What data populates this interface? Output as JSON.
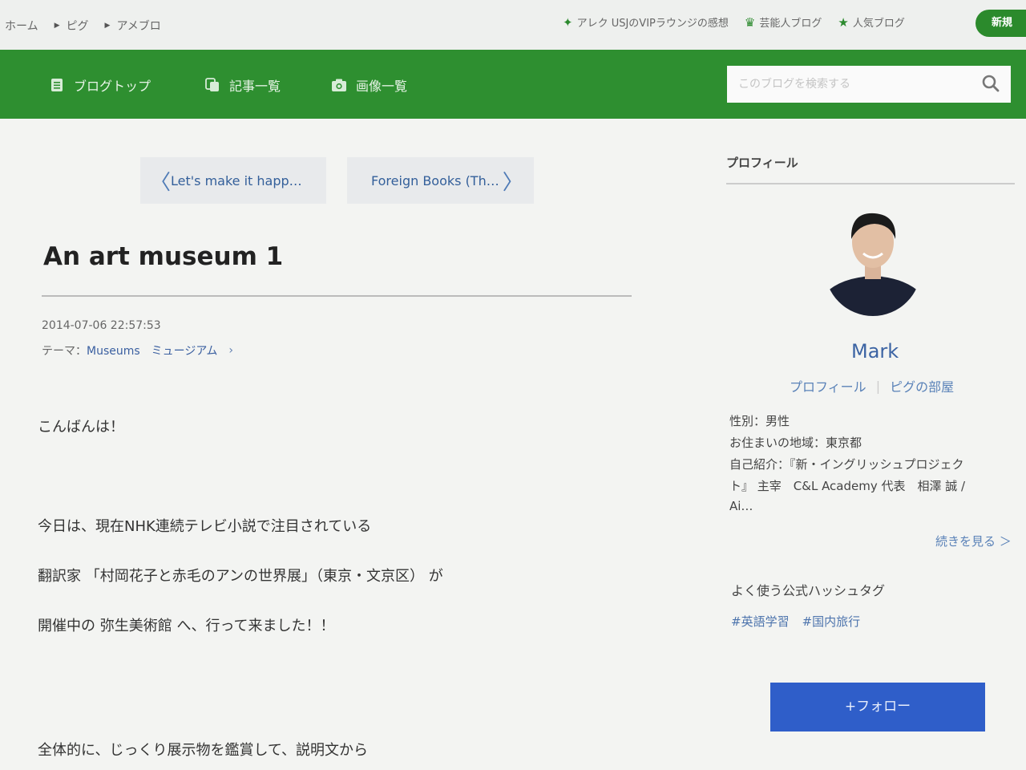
{
  "breadcrumb": [
    "ホーム",
    "ピグ",
    "アメブロ"
  ],
  "header_links": [
    {
      "label": "アレク USJのVIPラウンジの感想",
      "icon": "sparkle-icon"
    },
    {
      "label": "芸能人ブログ",
      "icon": "crown-icon"
    },
    {
      "label": "人気ブログ",
      "icon": "star-icon"
    }
  ],
  "new_button_label": "新規",
  "nav": {
    "items": [
      {
        "label": "ブログトップ",
        "icon": "document-icon"
      },
      {
        "label": "記事一覧",
        "icon": "copy-icon"
      },
      {
        "label": "画像一覧",
        "icon": "camera-icon"
      }
    ],
    "search_placeholder": "このブログを検索する"
  },
  "article": {
    "prev_label": "Let's make it happ…",
    "next_label": "Foreign Books (Th…",
    "title": "An art museum 1",
    "date": "2014-07-06 22:57:53",
    "theme_prefix": "テーマ：",
    "theme_link": "Museums　ミュージアム",
    "body": [
      "こんばんは！",
      "今日は、現在NHK連続テレビ小説で注目されている",
      "翻訳家 「村岡花子と赤毛のアンの世界展」（東京・文京区） が",
      "開催中の 弥生美術館 へ、行って来ました！！",
      "全体的に、じっくり展示物を鑑賞して、説明文から"
    ]
  },
  "sidebar": {
    "heading": "プロフィール",
    "username": "Mark",
    "links": [
      "プロフィール",
      "ピグの部屋"
    ],
    "info": [
      "性別：男性",
      "お住まいの地域：東京都",
      "自己紹介：『新・イングリッシュプロジェク",
      "ト』 主宰　C&L Academy 代表　相澤 誠 /",
      "Ai…"
    ],
    "more_label": "続きを見る ＞",
    "hashtag_heading": "よく使う公式ハッシュタグ",
    "hashtags": [
      "#英語学習",
      "#国内旅行"
    ],
    "follow_label": "+フォロー"
  },
  "colors": {
    "nav_green": "#2e8f30",
    "link_blue": "#3b63a3",
    "follow_blue": "#2f5ec9"
  }
}
